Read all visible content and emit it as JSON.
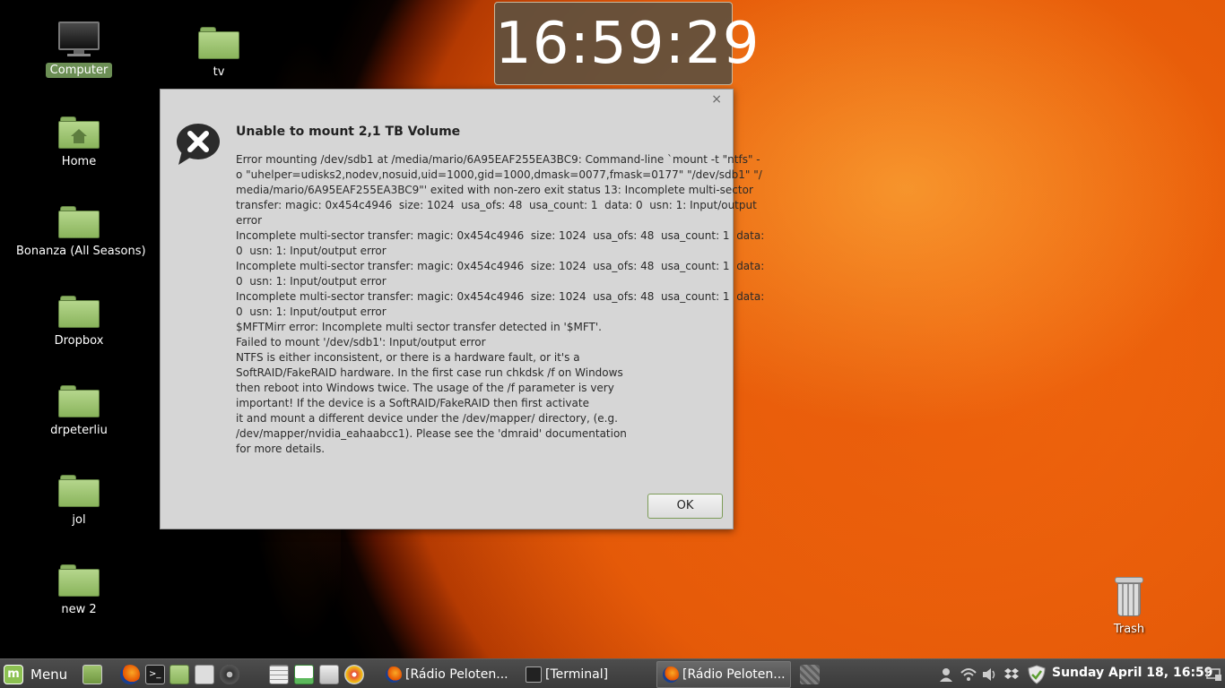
{
  "desktop": {
    "icons": [
      {
        "label": "Computer"
      },
      {
        "label": "tv"
      },
      {
        "label": "Home"
      },
      {
        "label": "Bonanza (All Seasons)"
      },
      {
        "label": "Dropbox"
      },
      {
        "label": "drpeterliu"
      },
      {
        "label": "jol"
      },
      {
        "label": "new 2"
      },
      {
        "label": "Trash"
      }
    ]
  },
  "clock_desklet": {
    "time": "16:59:29"
  },
  "dialog": {
    "title": "Unable to mount 2,1 TB Volume",
    "close_glyph": "×",
    "message_lines": [
      "Error mounting /dev/sdb1 at /media/mario/6A95EAF255EA3BC9: Command-line `mount -t \"ntfs\" -",
      "o \"uhelper=udisks2,nodev,nosuid,uid=1000,gid=1000,dmask=0077,fmask=0177\" \"/dev/sdb1\" \"/",
      "media/mario/6A95EAF255EA3BC9\"' exited with non-zero exit status 13: Incomplete multi-sector",
      "transfer: magic: 0x454c4946  size: 1024  usa_ofs: 48  usa_count: 1  data: 0  usn: 1: Input/output",
      "error",
      "Incomplete multi-sector transfer: magic: 0x454c4946  size: 1024  usa_ofs: 48  usa_count: 1  data:",
      "0  usn: 1: Input/output error",
      "Incomplete multi-sector transfer: magic: 0x454c4946  size: 1024  usa_ofs: 48  usa_count: 1  data:",
      "0  usn: 1: Input/output error",
      "Incomplete multi-sector transfer: magic: 0x454c4946  size: 1024  usa_ofs: 48  usa_count: 1  data:",
      "0  usn: 1: Input/output error",
      "$MFTMirr error: Incomplete multi sector transfer detected in '$MFT'.",
      "Failed to mount '/dev/sdb1': Input/output error",
      "NTFS is either inconsistent, or there is a hardware fault, or it's a",
      "SoftRAID/FakeRAID hardware. In the first case run chkdsk /f on Windows",
      "then reboot into Windows twice. The usage of the /f parameter is very",
      "important! If the device is a SoftRAID/FakeRAID then first activate",
      "it and mount a different device under the /dev/mapper/ directory, (e.g.",
      "/dev/mapper/nvidia_eahaabcc1). Please see the 'dmraid' documentation",
      "for more details."
    ],
    "ok_label": "OK"
  },
  "taskbar": {
    "menu_label": "Menu",
    "menu_logo": "m",
    "launchers": [
      "show-desktop-icon",
      "firefox-icon",
      "terminal-icon",
      "files-icon",
      "software-manager-icon",
      "media-player-icon",
      "calculator-icon",
      "spreadsheet-icon",
      "archive-icon",
      "disc-burner-icon"
    ],
    "tasks": [
      {
        "label": "[Rádio Peloten...",
        "icon": "firefox-icon",
        "active": false
      },
      {
        "label": "[Terminal]",
        "icon": "terminal-icon",
        "active": false
      },
      {
        "label": "[Rádio Peloten...",
        "icon": "firefox-icon",
        "active": true
      }
    ],
    "tray_icons": [
      "user-icon",
      "wifi-icon",
      "volume-icon",
      "dropbox-icon",
      "update-shield-icon",
      "display-icon"
    ],
    "clock": "Sunday April 18, 16:59"
  },
  "colors": {
    "selection": "#6c8f55",
    "folder": "#8ab45c",
    "dialog_bg": "#d6d6d6",
    "ok_border": "#7d9c58",
    "clock_bg": "#5f503e"
  }
}
